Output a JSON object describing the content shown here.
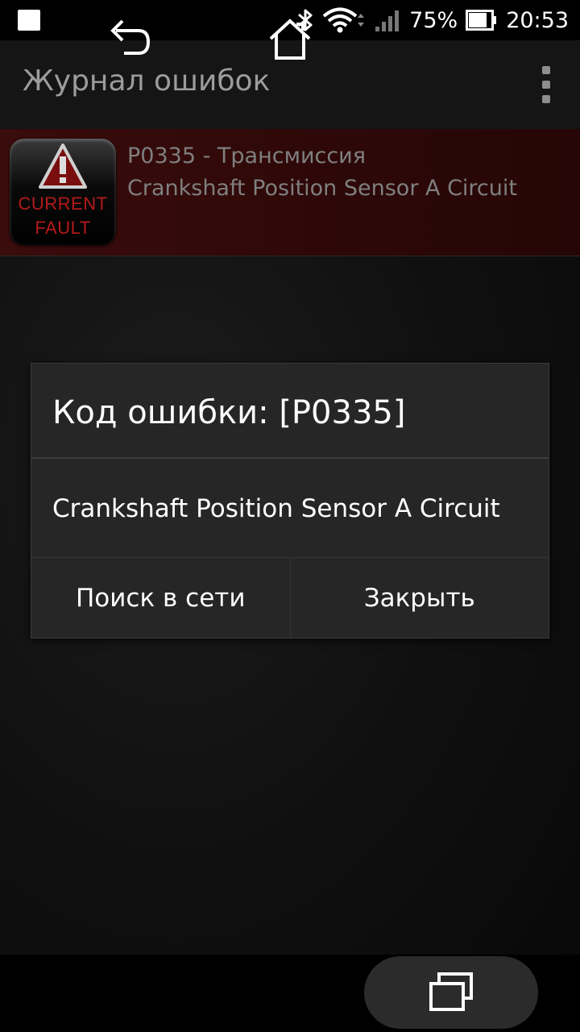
{
  "status_bar": {
    "battery_percent": "75%",
    "time": "20:53",
    "icons": [
      "notification-square-icon",
      "bluetooth-icon",
      "wifi-icon",
      "cell-signal-icon",
      "battery-icon"
    ]
  },
  "app_bar": {
    "title": "Журнал ошибок",
    "menu_icon": "overflow-menu-icon"
  },
  "fault_list": [
    {
      "icon_lines": [
        "CURRENT",
        "FAULT"
      ],
      "code_line": "P0335 - Трансмиссия",
      "description": "Crankshaft Position Sensor A Circuit"
    }
  ],
  "dialog": {
    "title": "Код ошибки: [P0335]",
    "message": "Crankshaft Position Sensor A Circuit",
    "buttons": {
      "search": "Поиск в сети",
      "close": "Закрыть"
    }
  },
  "nav_bar": {
    "icons": [
      "back-icon",
      "home-icon",
      "recents-icon"
    ]
  },
  "colors": {
    "fault_row_bg": "#3a0c0c",
    "dialog_bg": "#262626",
    "fault_icon_text": "#b51a1a"
  }
}
